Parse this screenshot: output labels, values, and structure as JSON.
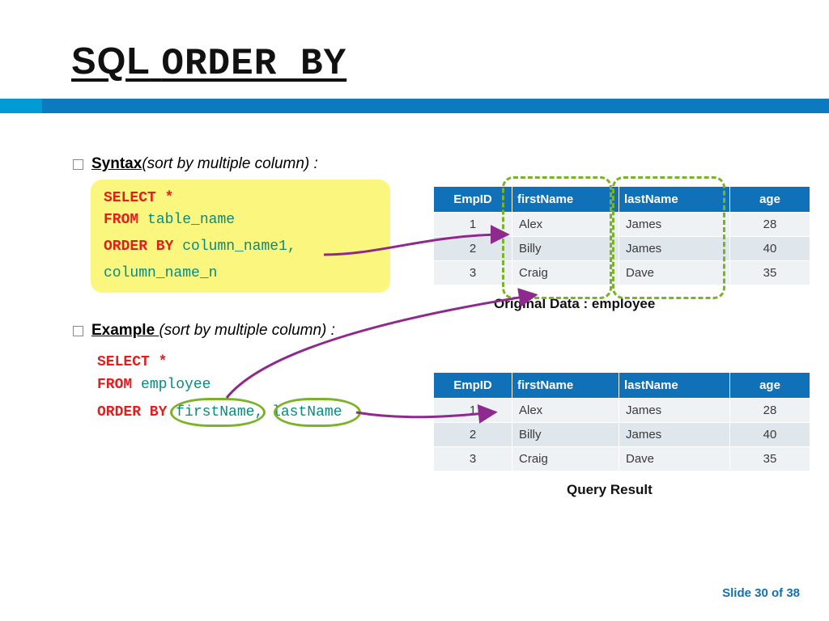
{
  "title_part1": "SQL",
  "title_part2": "ORDER BY",
  "bullet_syntax_label": "Syntax",
  "bullet_syntax_suffix": "(sort by multiple column) :",
  "bullet_example_label": "Example ",
  "bullet_example_suffix": "(sort by multiple column) :",
  "syntax": {
    "select": "SELECT",
    "star": "*",
    "from": "FROM",
    "table_name": "table_name",
    "order_by": "ORDER BY",
    "col1": "column_name1,",
    "coln": "column_name_n"
  },
  "example": {
    "select": "SELECT",
    "star": "*",
    "from": "FROM",
    "table": "employee",
    "order_by": "ORDER BY",
    "col1": "firstName",
    "comma": ",",
    "col2": "lastName"
  },
  "table_headers": {
    "empID": "EmpID",
    "firstName": "firstName",
    "lastName": "lastName",
    "age": "age"
  },
  "original_rows": [
    {
      "id": "1",
      "fn": "Alex",
      "ln": "James",
      "age": "28"
    },
    {
      "id": "2",
      "fn": "Billy",
      "ln": "James",
      "age": "40"
    },
    {
      "id": "3",
      "fn": "Craig",
      "ln": "Dave",
      "age": "35"
    }
  ],
  "result_rows": [
    {
      "id": "1",
      "fn": "Alex",
      "ln": "James",
      "age": "28"
    },
    {
      "id": "2",
      "fn": "Billy",
      "ln": "James",
      "age": "40"
    },
    {
      "id": "3",
      "fn": "Craig",
      "ln": "Dave",
      "age": "35"
    }
  ],
  "caption_original": "Original Data : employee",
  "caption_result": "Query Result",
  "footer": "Slide 30 of 38"
}
